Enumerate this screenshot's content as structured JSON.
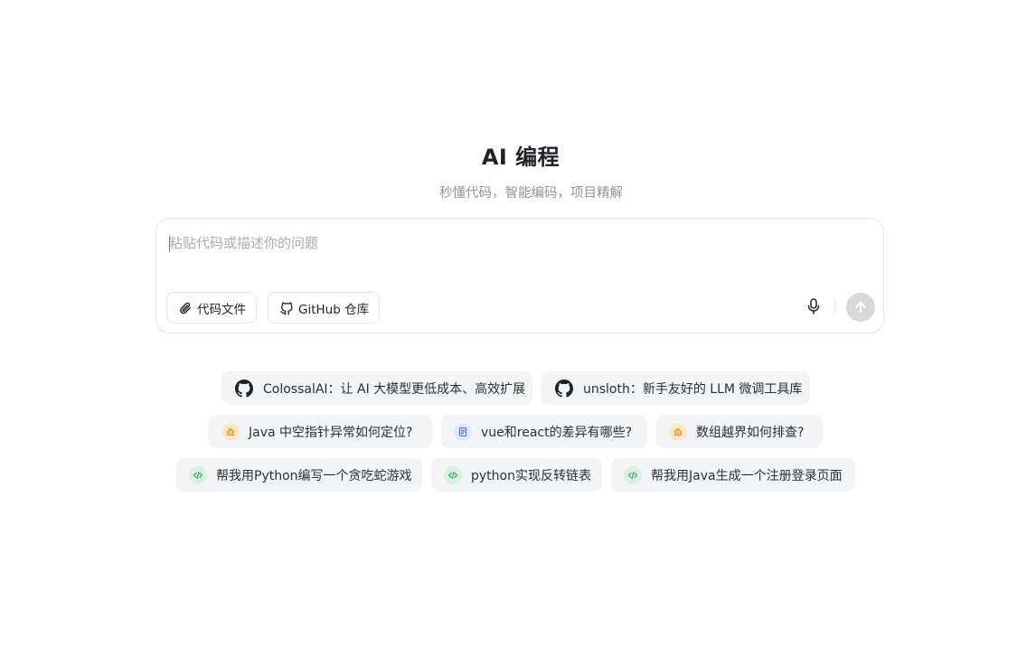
{
  "header": {
    "title": "AI 编程",
    "subtitle": "秒懂代码，智能编码，项目精解"
  },
  "composer": {
    "placeholder": "粘贴代码或描述你的问题",
    "file_button_label": "代码文件",
    "github_button_label": "GitHub 仓库",
    "mic_icon": "microphone-icon",
    "send_icon": "arrow-up-icon"
  },
  "suggestions": {
    "row1": [
      {
        "label": "ColossalAI：让 AI 大模型更低成本、高效扩展",
        "icon": "github-icon"
      },
      {
        "label": "unsloth：新手友好的 LLM 微调工具库",
        "icon": "github-icon"
      }
    ],
    "row2": [
      {
        "label": "Java 中空指针异常如何定位?",
        "icon": "bug-icon"
      },
      {
        "label": "vue和react的差异有哪些?",
        "icon": "document-icon"
      },
      {
        "label": "数组越界如何排查?",
        "icon": "bug-icon"
      }
    ],
    "row3": [
      {
        "label": "帮我用Python编写一个贪吃蛇游戏",
        "icon": "code-icon"
      },
      {
        "label": "python实现反转链表",
        "icon": "code-icon"
      },
      {
        "label": "帮我用Java生成一个注册登录页面",
        "icon": "code-icon"
      }
    ]
  },
  "colors": {
    "bug_icon_bg": "#fde7c8",
    "doc_icon_bg": "#dfe8ff",
    "code_icon_bg": "#d9f2e0",
    "chip_bg": "#f3f4f6",
    "send_disabled": "#d6d8dc"
  }
}
